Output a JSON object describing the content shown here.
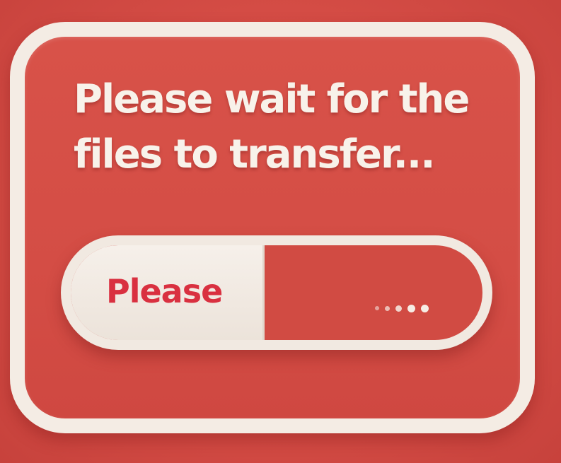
{
  "dialog": {
    "message": "Please wait for the files to transfer...",
    "progress": {
      "label": "Please",
      "fraction": 0.47
    }
  },
  "colors": {
    "background": "#d64c44",
    "border": "#f4ece4",
    "text": "#f8f2ea",
    "progress_label": "#d93040"
  },
  "icons": {
    "loading": "loading-dots-icon"
  }
}
